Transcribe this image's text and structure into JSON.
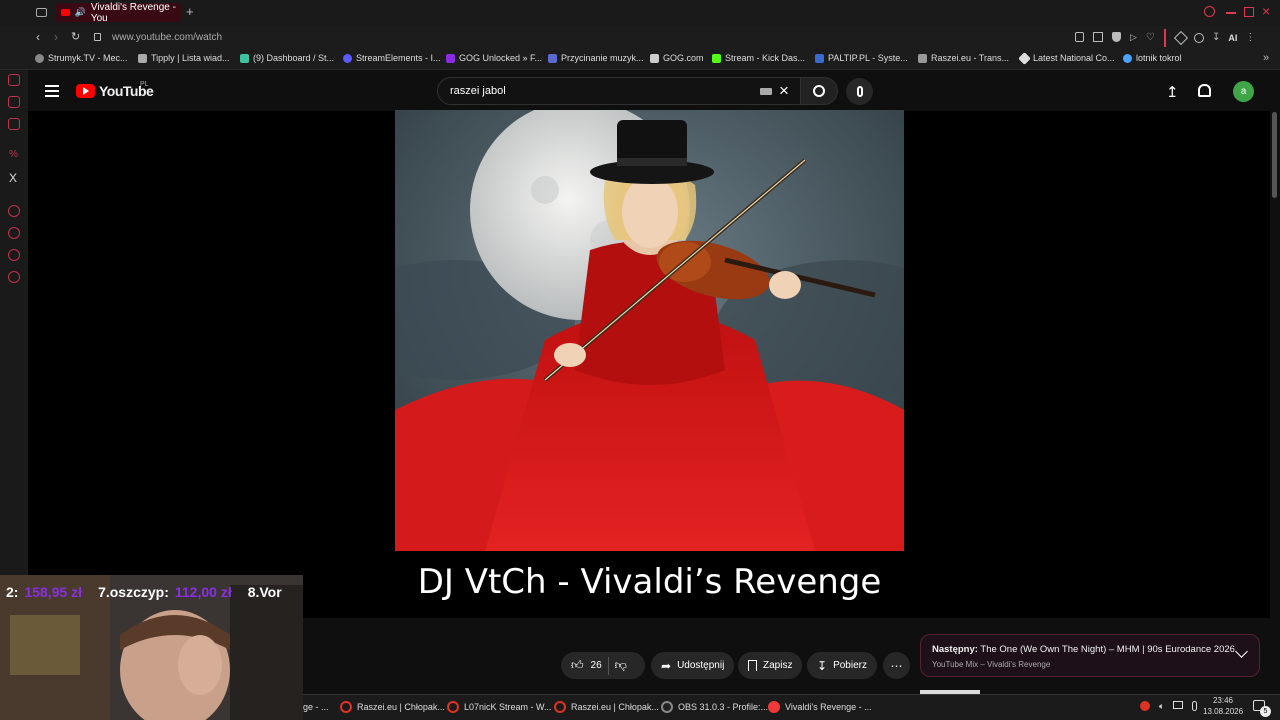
{
  "browser": {
    "active_tab_title": "Vivaldi's Revenge - You",
    "url": "www.youtube.com/watch",
    "bookmarks": [
      "Strumyk.TV - Mec...",
      "Tipply | Lista wiad...",
      "(9) Dashboard / St...",
      "StreamElements - I...",
      "GOG Unlocked » F...",
      "Przycinanie muzyk...",
      "GOG.com",
      "Stream - Kick Das...",
      "PALTIP.PL - Syste...",
      "Raszei.eu - Trans...",
      "Latest National Co...",
      "lotnik tokrol"
    ],
    "ai_label": "AI",
    "sidebar_x_label": "X"
  },
  "youtube": {
    "logo_text": "YouTube",
    "region": "PL",
    "search_value": "raszei jabol",
    "avatar_letter": "a",
    "video_title_overlay": "DJ VtCh - Vivaldi’s Revenge",
    "likes": "26",
    "share_label": "Udostępnij",
    "save_label": "Zapisz",
    "download_label": "Pobierz",
    "next": {
      "prefix": "Następny:",
      "title": "The One (We Own The Night) – MHM | 90s Eurodance 2026",
      "subtitle": "YouTube Mix – Vivaldi’s Revenge"
    },
    "colors": {
      "accent": "#ff0000",
      "avatar": "#3ea646",
      "vivaldi_red": "#ef3939"
    }
  },
  "stream_overlay": {
    "ticker": [
      "2:",
      "158,95 zł",
      "7.oszczyp:",
      "112,00 zł",
      "8.Vor"
    ]
  },
  "taskbar": {
    "items": [
      "ge - ...",
      "Raszei.eu | Chłopak...",
      "L07nicK Stream - W...",
      "Raszei.eu | Chłopak...",
      "OBS 31.0.3 - Profile:...",
      "Vivaldi's Revenge - ..."
    ],
    "time": "23:46",
    "date": "13.08.2026",
    "notification_count": "5"
  }
}
